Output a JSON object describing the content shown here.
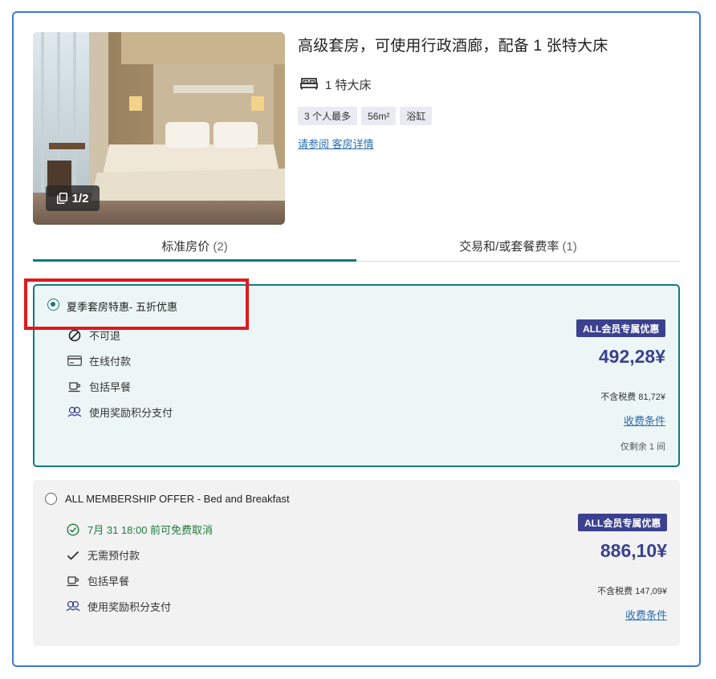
{
  "room": {
    "title": "高级套房，可使用行政酒廊，配备 1 张特大床",
    "bed": "1 特大床",
    "chips": [
      "3 个人最多",
      "56m²",
      "浴缸"
    ],
    "detail_link": "请参阅 客房详情",
    "photo_counter": "1/2"
  },
  "tabs": [
    {
      "label": "标准房价",
      "count": "(2)"
    },
    {
      "label": "交易和/或套餐费率",
      "count": "(1)"
    }
  ],
  "rates": [
    {
      "name": "夏季套房特惠- 五折优惠",
      "selected": true,
      "features": [
        {
          "icon": "no-entry-icon",
          "text": "不可退"
        },
        {
          "icon": "credit-card-icon",
          "text": "在线付款"
        },
        {
          "icon": "coffee-cup-icon",
          "text": "包括早餐"
        },
        {
          "icon": "reward-points-icon",
          "text": "使用奖励积分支付"
        }
      ],
      "badge": "ALL会员专属优惠",
      "price": "492,28¥",
      "tax": "不含税费 81,72¥",
      "fee_link": "收费条件",
      "remaining": "仅剩余 1 间"
    },
    {
      "name": "ALL MEMBERSHIP OFFER - Bed and Breakfast",
      "selected": false,
      "features": [
        {
          "icon": "check-circle-icon",
          "text": "7月 31 18:00 前可免费取消"
        },
        {
          "icon": "checkmark-icon",
          "text": "无需预付款"
        },
        {
          "icon": "coffee-cup-icon",
          "text": "包括早餐"
        },
        {
          "icon": "reward-points-icon",
          "text": "使用奖励积分支付"
        }
      ],
      "badge": "ALL会员专属优惠",
      "price": "886,10¥",
      "tax": "不含税费 147,09¥",
      "fee_link": "收费条件"
    }
  ],
  "colors": {
    "accent_teal": "#127a7a",
    "member_blue": "#3b418f",
    "card_border": "#3c7ad3",
    "highlight_red": "#e1191c",
    "link_blue": "#2b6cb0"
  }
}
